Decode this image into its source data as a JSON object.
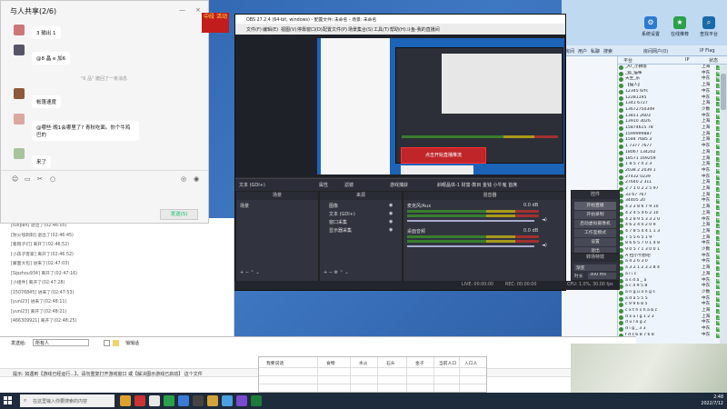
{
  "chat": {
    "title": "与人共享(2/6)",
    "messages": [
      {
        "text": "3 输出 1"
      },
      {
        "text": "@8 晶 e 加6"
      },
      {
        "text": "帐篷速度"
      },
      {
        "text": "@哪些 晚1会哪里了? 青秋吃面。你个牛鸡巴的"
      },
      {
        "text": "来了"
      }
    ],
    "system_msg": "\"6 品\" 撤回了一条消息",
    "send_button": "发送(S)",
    "close_icon": "×",
    "minimize_icon": "—"
  },
  "log": {
    "lines": [
      "[tulipan] 退出了(02:46:05)",
      "[防火毯刺刺] 退出了(02:46:45)",
      "[看刚子们] 离开了(02:46:52)",
      "[小孩子客家] 离开了(02:46:52)",
      "[蒙面大包] 进来了(02:47:03)",
      "[Sipzhou934] 离开了(02:47:16)",
      "[小组件] 离开了(02:47:28)",
      "[15076845] 进来了(02:47:53)",
      "[yuni23] 进来了(02:48:11)",
      "[yuni23] 离开了(02:48:21)",
      "[466309921] 离开了(02:48:25)"
    ]
  },
  "console": {
    "send_to_label": "发送给:",
    "send_to_value": "所有人",
    "private_chat_label": "悄悄话",
    "tip": "提示: 如遇到【游戏已经运行...】，请勿重复打开游戏窗口 或【解决图示游戏已启动】 这个文件",
    "sheet_headers": [
      "我要说话",
      "食物",
      "水火",
      "石头",
      "金子",
      "当前人口",
      "入口人"
    ]
  },
  "obs": {
    "title": "OBS 27.2.4 (64-bit, windows) - 配置文件: 未命名 - 场景: 未命名",
    "menu": [
      "文件(F)",
      "编辑(E)",
      "视图(V)",
      "停靠窗口(D)",
      "配置文件(P)",
      "场景集合(S)",
      "工具(T)",
      "帮助(H)",
      "斗鱼-我的直播间"
    ],
    "scene_bar": [
      "文本 (GDI+)",
      "属性",
      "滤镜",
      "游戏捕获",
      "斜眼晶体-1 财富-数目 金钱 小牛鬼 首席"
    ],
    "docks": {
      "scenes": {
        "header": "场景",
        "items": [
          "场景"
        ]
      },
      "sources": {
        "header": "来源",
        "items": [
          "图像",
          "文本 (GDI+)",
          "窗口采集",
          "显示器采集"
        ]
      },
      "mixer": {
        "header": "混音器",
        "tracks": [
          {
            "name": "麦克风/Aux",
            "db": "0.0 dB"
          },
          {
            "name": "桌面音频",
            "db": "0.0 dB"
          }
        ]
      },
      "controls": {
        "header": "控件",
        "buttons": [
          "开始直播",
          "开始录制",
          "启动虚拟摄像机",
          "工作室模式",
          "设置",
          "退出"
        ]
      },
      "transitions": {
        "header": "转场特效",
        "type": "渐变",
        "duration_label": "时长",
        "duration": "300 ms"
      }
    },
    "preview_overlay": "点击开始直播推流",
    "status": {
      "live": "LIVE: 00:00:00",
      "rec": "REC: 00:00:00",
      "cpu": "CPU: 1.0%, 30.00 fps"
    }
  },
  "right_app": {
    "top_buttons": [
      "系统设置",
      "在线推荐",
      "查找平台"
    ],
    "tabs": [
      "房间",
      "用户",
      "私聊",
      "搜索",
      "房间网户(0)",
      "IP Flag"
    ],
    "columns": [
      "平台",
      "IP",
      "状态"
    ],
    "rows": [
      {
        "name": "_AT_小狮客",
        "area": "上海",
        "flag": "上"
      },
      {
        "name": "_狐_猫咪",
        "area": "中东",
        "flag": "中"
      },
      {
        "name": "天生_乐",
        "area": "中东",
        "flag": "中"
      },
      {
        "name": "【猫人】",
        "area": "上海",
        "flag": "上"
      },
      {
        "name": "12345 6rfs",
        "area": "中东",
        "flag": "中"
      },
      {
        "name": "12281195",
        "area": "中东",
        "flag": "中"
      },
      {
        "name": "1341 6727",
        "area": "上海",
        "flag": "上"
      },
      {
        "name": "13672750349",
        "area": "少数",
        "flag": "少"
      },
      {
        "name": "13811 2603",
        "area": "中东",
        "flag": "中"
      },
      {
        "name": "13910 3026",
        "area": "上海",
        "flag": "上"
      },
      {
        "name": "15874615 78",
        "area": "上海",
        "flag": "上"
      },
      {
        "name": "1599999887",
        "area": "上海",
        "flag": "上"
      },
      {
        "name": "1584 7685 3",
        "area": "上海",
        "flag": "上"
      },
      {
        "name": "1 7377 7677",
        "area": "中东",
        "flag": "中"
      },
      {
        "name": "18067 134202",
        "area": "上海",
        "flag": "上"
      },
      {
        "name": "18571 169259",
        "area": "上海",
        "flag": "上"
      },
      {
        "name": "1 8 5 7 0 2 3",
        "area": "上海",
        "flag": "上"
      },
      {
        "name": "2038 2 2039 1",
        "area": "中东",
        "flag": "中"
      },
      {
        "name": "27432 0239",
        "area": "中东",
        "flag": "中"
      },
      {
        "name": "27640 2 311",
        "area": "上海",
        "flag": "上"
      },
      {
        "name": "2 7 1 0 2 2 5 97",
        "area": "上海",
        "flag": "上"
      },
      {
        "name": "33 67 767",
        "area": "上海",
        "flag": "上"
      },
      {
        "name": "34405 20",
        "area": "中东",
        "flag": "中"
      },
      {
        "name": "4 2 2 8 6 7 9 10",
        "area": "上海",
        "flag": "上"
      },
      {
        "name": "4 2 4 5 4 6 2 10",
        "area": "上海",
        "flag": "上"
      },
      {
        "name": "4 2 8 9 5 3 3 2 0",
        "area": "中东",
        "flag": "中"
      },
      {
        "name": "4 6 2 4 0 2 0 9",
        "area": "上海",
        "flag": "上"
      },
      {
        "name": "4 7 8 5 4 4 1 1 3",
        "area": "上海",
        "flag": "上"
      },
      {
        "name": "7 5 5 6 5 1 9",
        "area": "上海",
        "flag": "上"
      },
      {
        "name": "8 6 6 5 7 0 1 4 8",
        "area": "中东",
        "flag": "中"
      },
      {
        "name": "9 0 5 7 1 3 0 0 1",
        "area": "少数",
        "flag": "少"
      },
      {
        "name": "A 拉小卡想吧",
        "area": "中东",
        "flag": "中"
      },
      {
        "name": "a 4 2 6 3 0",
        "area": "中东",
        "flag": "中"
      },
      {
        "name": "a 3 2 1 2 3 2 8 4",
        "area": "上海",
        "flag": "上"
      },
      {
        "name": "a l i c",
        "area": "上海",
        "flag": "上"
      },
      {
        "name": "a s d a _ a",
        "area": "中东",
        "flag": "中"
      },
      {
        "name": "a c 4 9 5 8",
        "area": "中东",
        "flag": "中"
      },
      {
        "name": "a n g u a n g s",
        "area": "少数",
        "flag": "少"
      },
      {
        "name": "a d a 5 5 5",
        "area": "中东",
        "flag": "中"
      },
      {
        "name": "c 9 9 6 8 5",
        "area": "中东",
        "flag": "中"
      },
      {
        "name": "c x t h s h a b c",
        "area": "上海",
        "flag": "上"
      },
      {
        "name": "d x u l g 1 2 3",
        "area": "上海",
        "flag": "上"
      },
      {
        "name": "d u l a g 2",
        "area": "中东",
        "flag": "中"
      },
      {
        "name": "d i g _ 3 3",
        "area": "中东",
        "flag": "中"
      },
      {
        "name": "f d s 6 8 7 6 8",
        "area": "中东",
        "flag": "中"
      }
    ]
  },
  "taskbar": {
    "search_placeholder": "在这里输入你要搜索的内容",
    "time": "2:48",
    "date": "2022/7/12"
  },
  "promo": {
    "text": "中段 活动"
  }
}
